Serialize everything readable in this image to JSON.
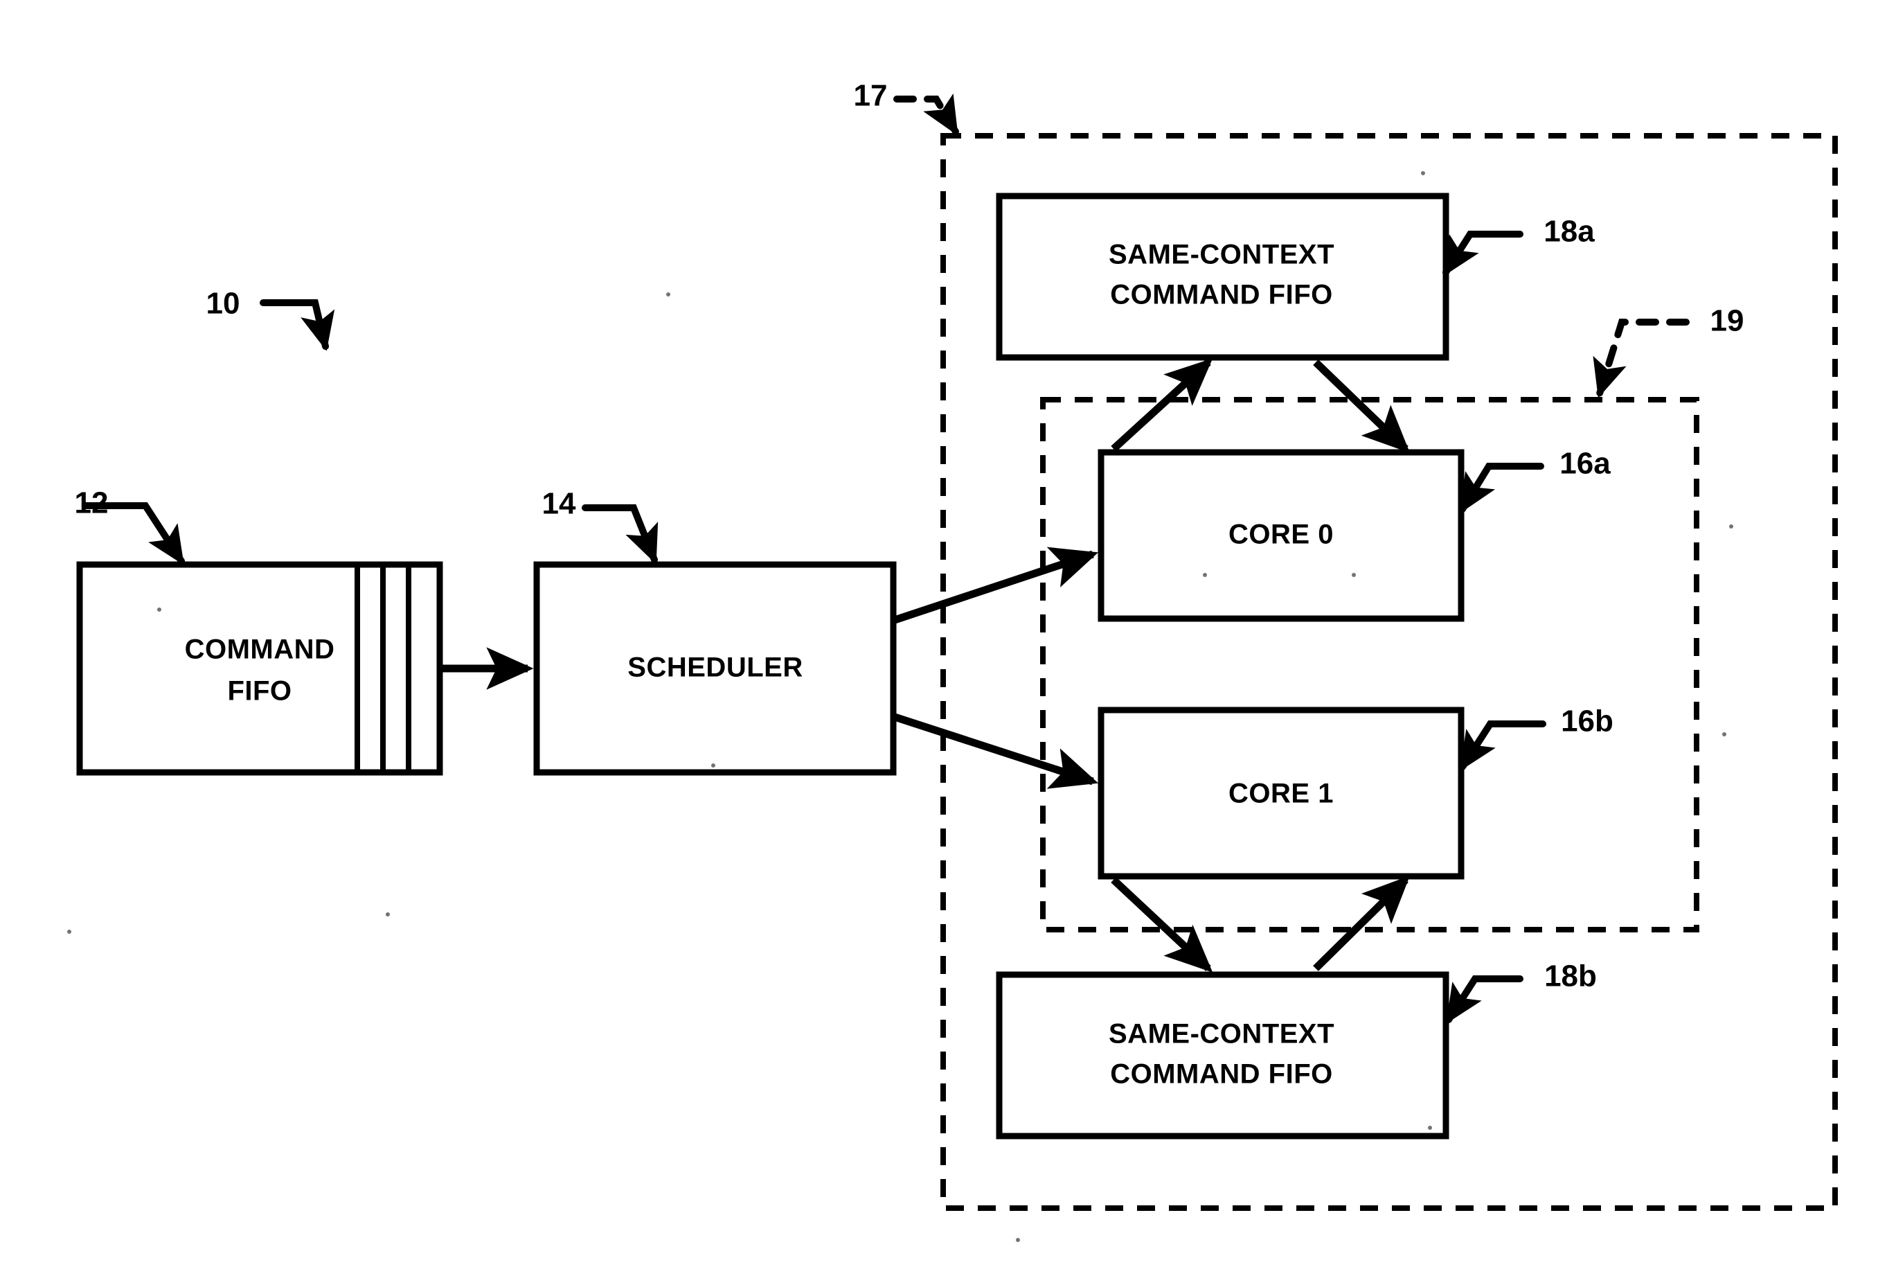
{
  "figure": {
    "title": "Multi-core command scheduling block diagram",
    "background_color": "#ffffff",
    "line_color": "#000000"
  },
  "blocks": [
    {
      "id": "command_fifo",
      "ref": "12",
      "label_line1": "COMMAND",
      "label_line2": "FIFO",
      "style": "solid"
    },
    {
      "id": "scheduler",
      "ref": "14",
      "label_line1": "SCHEDULER",
      "label_line2": "",
      "style": "solid"
    },
    {
      "id": "same_context_fifo_top",
      "ref": "18a",
      "label_line1": "SAME-CONTEXT",
      "label_line2": "COMMAND FIFO",
      "style": "solid"
    },
    {
      "id": "core0",
      "ref": "16a",
      "label_line1": "CORE 0",
      "label_line2": "",
      "style": "solid"
    },
    {
      "id": "core1",
      "ref": "16b",
      "label_line1": "CORE 1",
      "label_line2": "",
      "style": "solid"
    },
    {
      "id": "same_context_fifo_bottom",
      "ref": "18b",
      "label_line1": "SAME-CONTEXT",
      "label_line2": "COMMAND FIFO",
      "style": "solid"
    }
  ],
  "reference_numerals": {
    "system": "10",
    "command_fifo": "12",
    "scheduler": "14",
    "core_a": "16a",
    "core_b": "16b",
    "outer_dashed_group": "17",
    "fifo_a": "18a",
    "fifo_b": "18b",
    "inner_dashed_group": "19"
  },
  "labels": {
    "command_fifo_line1": "COMMAND",
    "command_fifo_line2": "FIFO",
    "scheduler": "SCHEDULER",
    "same_context_top_line1": "SAME-CONTEXT",
    "same_context_top_line2": "COMMAND FIFO",
    "core0": "CORE 0",
    "core1": "CORE 1",
    "same_context_bottom_line1": "SAME-CONTEXT",
    "same_context_bottom_line2": "COMMAND FIFO"
  },
  "connections": [
    {
      "from": "command_fifo",
      "to": "scheduler",
      "type": "arrow",
      "direction": "right"
    },
    {
      "from": "scheduler",
      "to": "core0",
      "type": "arrow",
      "direction": "up-right"
    },
    {
      "from": "scheduler",
      "to": "core1",
      "type": "arrow",
      "direction": "down-right"
    },
    {
      "from": "core0",
      "to": "same_context_fifo_top",
      "type": "arrow",
      "direction": "up-left"
    },
    {
      "from": "same_context_fifo_top",
      "to": "core0",
      "type": "arrow",
      "direction": "down-right"
    },
    {
      "from": "core1",
      "to": "same_context_fifo_bottom",
      "type": "arrow",
      "direction": "down-left"
    },
    {
      "from": "same_context_fifo_bottom",
      "to": "core1",
      "type": "arrow",
      "direction": "up-right"
    }
  ]
}
